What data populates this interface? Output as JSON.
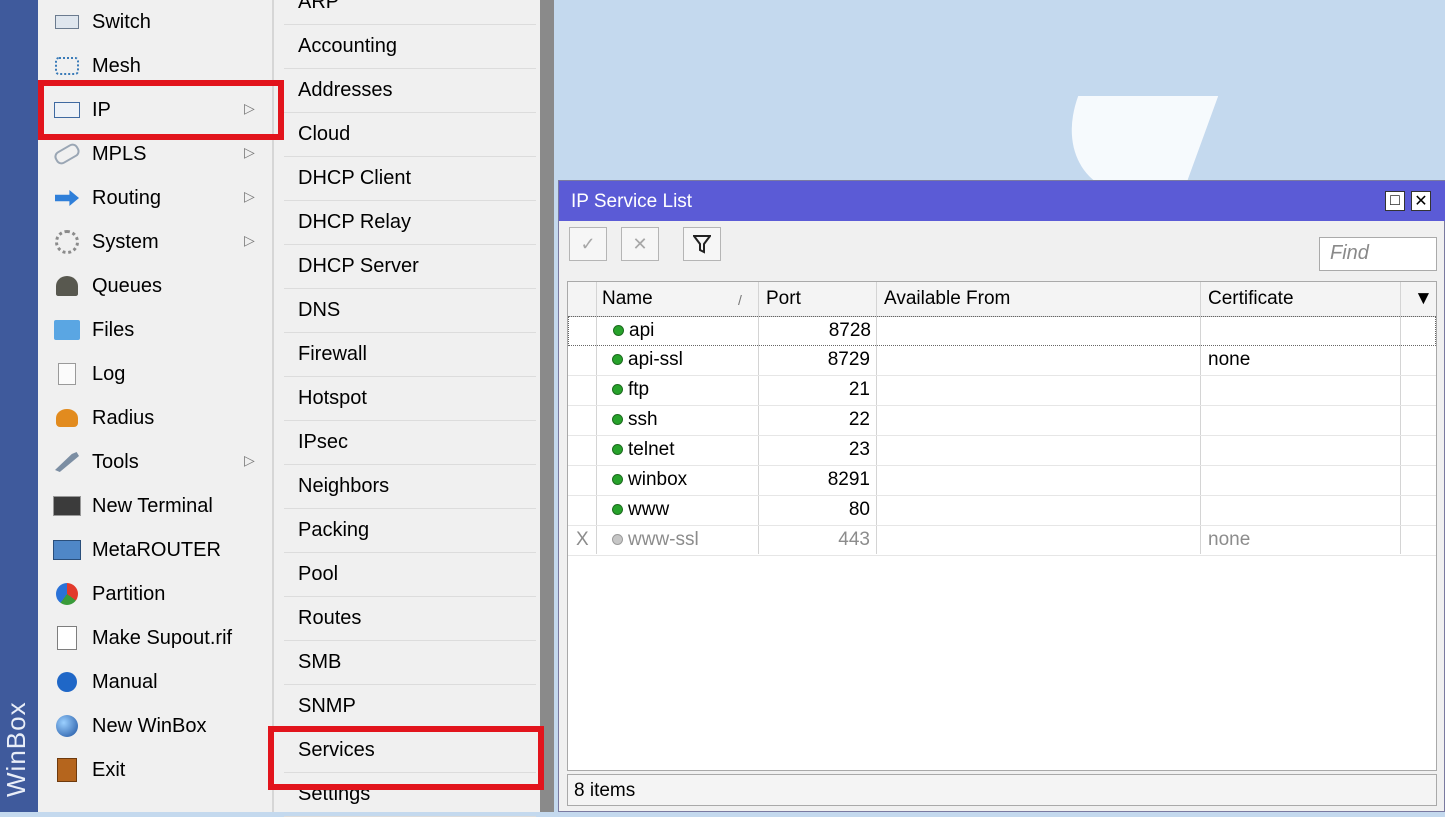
{
  "brand": "WinBox",
  "main_menu": {
    "items": [
      {
        "label": "Switch",
        "icon": "switch-icon",
        "arrow": false
      },
      {
        "label": "Mesh",
        "icon": "mesh-icon",
        "arrow": false
      },
      {
        "label": "IP",
        "icon": "ip-icon",
        "arrow": true,
        "highlighted": true
      },
      {
        "label": "MPLS",
        "icon": "mpls-icon",
        "arrow": true
      },
      {
        "label": "Routing",
        "icon": "routing-icon",
        "arrow": true
      },
      {
        "label": "System",
        "icon": "system-gear-icon",
        "arrow": true
      },
      {
        "label": "Queues",
        "icon": "queues-icon",
        "arrow": false
      },
      {
        "label": "Files",
        "icon": "folder-icon",
        "arrow": false
      },
      {
        "label": "Log",
        "icon": "log-icon",
        "arrow": false
      },
      {
        "label": "Radius",
        "icon": "radius-users-icon",
        "arrow": false
      },
      {
        "label": "Tools",
        "icon": "tools-icon",
        "arrow": true
      },
      {
        "label": "New Terminal",
        "icon": "terminal-icon",
        "arrow": false
      },
      {
        "label": "MetaROUTER",
        "icon": "metarouter-icon",
        "arrow": false
      },
      {
        "label": "Partition",
        "icon": "pie-chart-icon",
        "arrow": false
      },
      {
        "label": "Make Supout.rif",
        "icon": "document-icon",
        "arrow": false
      },
      {
        "label": "Manual",
        "icon": "help-icon",
        "arrow": false
      },
      {
        "label": "New WinBox",
        "icon": "globe-icon",
        "arrow": false
      },
      {
        "label": "Exit",
        "icon": "exit-door-icon",
        "arrow": false
      }
    ],
    "arrow_glyph": "▷"
  },
  "sub_menu": {
    "items": [
      "ARP",
      "Accounting",
      "Addresses",
      "Cloud",
      "DHCP Client",
      "DHCP Relay",
      "DHCP Server",
      "DNS",
      "Firewall",
      "Hotspot",
      "IPsec",
      "Neighbors",
      "Packing",
      "Pool",
      "Routes",
      "SMB",
      "SNMP",
      "Services",
      "Settings"
    ],
    "highlighted": "Services"
  },
  "window": {
    "title": "IP Service List",
    "maximize_glyph": "□",
    "close_glyph": "✕",
    "toolbar": {
      "enable_glyph": "✓",
      "disable_glyph": "✕",
      "filter_glyph": "⛉"
    },
    "find_placeholder": "Find",
    "columns": {
      "name": "Name",
      "sort_glyph": "/",
      "port": "Port",
      "available_from": "Available From",
      "certificate": "Certificate",
      "dropdown_glyph": "▼"
    },
    "rows": [
      {
        "flag": "",
        "name": "api",
        "port": "8728",
        "available_from": "",
        "certificate": "",
        "disabled": false,
        "selected": true
      },
      {
        "flag": "",
        "name": "api-ssl",
        "port": "8729",
        "available_from": "",
        "certificate": "none",
        "disabled": false
      },
      {
        "flag": "",
        "name": "ftp",
        "port": "21",
        "available_from": "",
        "certificate": "",
        "disabled": false
      },
      {
        "flag": "",
        "name": "ssh",
        "port": "22",
        "available_from": "",
        "certificate": "",
        "disabled": false
      },
      {
        "flag": "",
        "name": "telnet",
        "port": "23",
        "available_from": "",
        "certificate": "",
        "disabled": false
      },
      {
        "flag": "",
        "name": "winbox",
        "port": "8291",
        "available_from": "",
        "certificate": "",
        "disabled": false
      },
      {
        "flag": "",
        "name": "www",
        "port": "80",
        "available_from": "",
        "certificate": "",
        "disabled": false
      },
      {
        "flag": "X",
        "name": "www-ssl",
        "port": "443",
        "available_from": "",
        "certificate": "none",
        "disabled": true
      }
    ],
    "status": "8 items"
  },
  "colors": {
    "highlight": "#e2141c",
    "titlebar": "#5b5bd6",
    "background": "#c4d9ee",
    "status_dot": "#27a22b"
  }
}
